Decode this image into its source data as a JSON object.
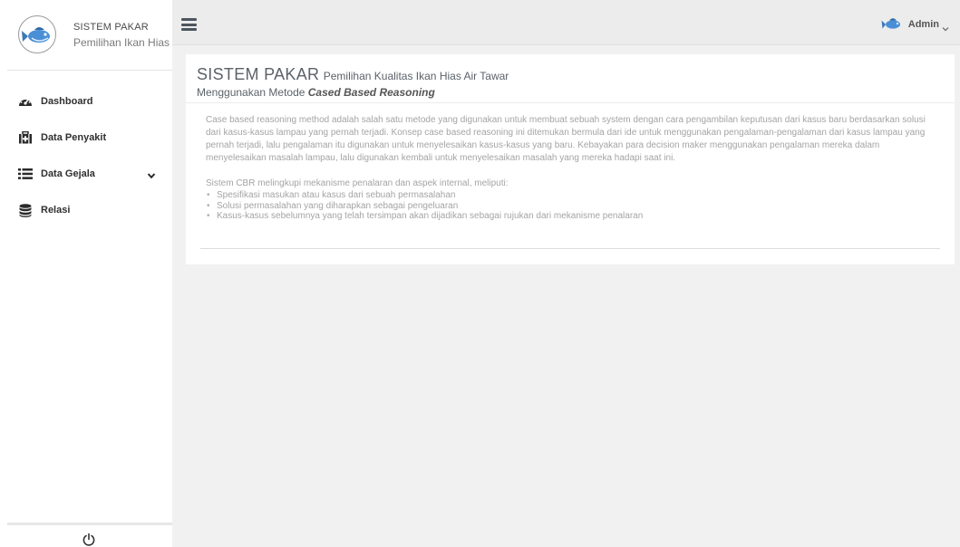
{
  "brand": {
    "title": "SISTEM PAKAR",
    "subtitle": "Pemilihan Ikan Hias"
  },
  "sidebar": {
    "items": [
      {
        "label": "Dashboard",
        "icon": "tachometer-icon"
      },
      {
        "label": "Data Penyakit",
        "icon": "medkit-icon"
      },
      {
        "label": "Data Gejala",
        "icon": "list-icon",
        "has_submenu": true
      },
      {
        "label": "Relasi",
        "icon": "database-icon"
      }
    ],
    "footer_icon": "power-icon"
  },
  "topbar": {
    "menu_icon": "hamburger-icon",
    "user_name": "Admin"
  },
  "content": {
    "title_big": "SISTEM PAKAR",
    "title_small": "Pemilihan Kualitas Ikan Hias Air Tawar",
    "subtitle_prefix": "Menggunakan Metode",
    "subtitle_method": "Cased Based Reasoning",
    "paragraph": "Case based reasoning method adalah salah satu metode yang digunakan untuk membuat sebuah system dengan cara pengambilan keputusan dari kasus baru berdasarkan solusi dari kasus-kasus lampau yang pernah terjadi. Konsep case based reasoning ini ditemukan bermula dari ide untuk menggunakan pengalaman-pengalaman dari kasus lampau yang pernah terjadi, lalu pengalaman itu digunakan untuk menyelesaikan kasus-kasus yang baru. Kebayakan para decision maker menggunakan pengalaman mereka dalam menyelesaikan masalah lampau, lalu digunakan kembali untuk menyelesaikan masalah yang mereka hadapi saat ini.",
    "list_intro": "Sistem CBR melingkupi mekanisme penalaran dan aspek internal, meliputi:",
    "list_items": [
      "Spesifikasi masukan atau kasus dari sebuah permasalahan",
      "Solusi permasalahan yang diharapkan sebagai pengeluaran",
      "Kasus-kasus sebelumnya yang telah tersimpan akan dijadikan sebagai rujukan dari mekanisme penalaran"
    ]
  },
  "colors": {
    "sidebar_bg": "#ffffff",
    "topbar_bg": "#ececec",
    "page_bg": "#f1f1f1",
    "logo_blue": "#4a8fd6"
  }
}
